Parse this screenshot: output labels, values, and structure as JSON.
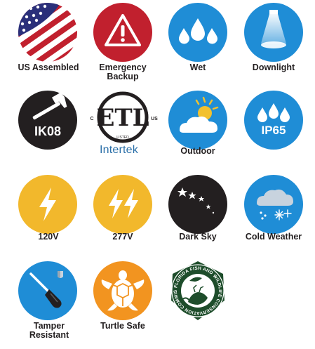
{
  "icons": [
    {
      "id": "us-assembled",
      "label": "US Assembled",
      "color": "#e0e0e0"
    },
    {
      "id": "emergency-backup",
      "label": "Emergency Backup",
      "color": "#c1202e"
    },
    {
      "id": "wet",
      "label": "Wet",
      "color": "#1f8dd6"
    },
    {
      "id": "downlight",
      "label": "Downlight",
      "color": "#1f8dd6"
    },
    {
      "id": "ik08",
      "label": "",
      "badge": "IK08",
      "color": "#231f20"
    },
    {
      "id": "etl",
      "label": "",
      "brand": "Intertek",
      "etl_text": "ETL",
      "c": "C",
      "us": "US",
      "listed": "LISTED",
      "color": "#2a6fa8"
    },
    {
      "id": "outdoor",
      "label": "Outdoor",
      "color": "#1f8dd6"
    },
    {
      "id": "ip65",
      "label": "",
      "badge": "IP65",
      "color": "#1f8dd6"
    },
    {
      "id": "v120",
      "label": "120V",
      "color": "#f2b82c"
    },
    {
      "id": "v277",
      "label": "277V",
      "color": "#f2b82c"
    },
    {
      "id": "dark-sky",
      "label": "Dark Sky",
      "color": "#231f20"
    },
    {
      "id": "cold-weather",
      "label": "Cold Weather",
      "color": "#1f8dd6"
    },
    {
      "id": "tamper-resistant",
      "label": "Tamper Resistant",
      "color": "#1f8dd6"
    },
    {
      "id": "turtle-safe",
      "label": "Turtle Safe",
      "color": "#f29420"
    },
    {
      "id": "fwc",
      "label": "",
      "seal_text": "FLORIDA FISH AND WILDLIFE CONSERVATION COMMISSION",
      "color": "#1e4d2b"
    }
  ]
}
